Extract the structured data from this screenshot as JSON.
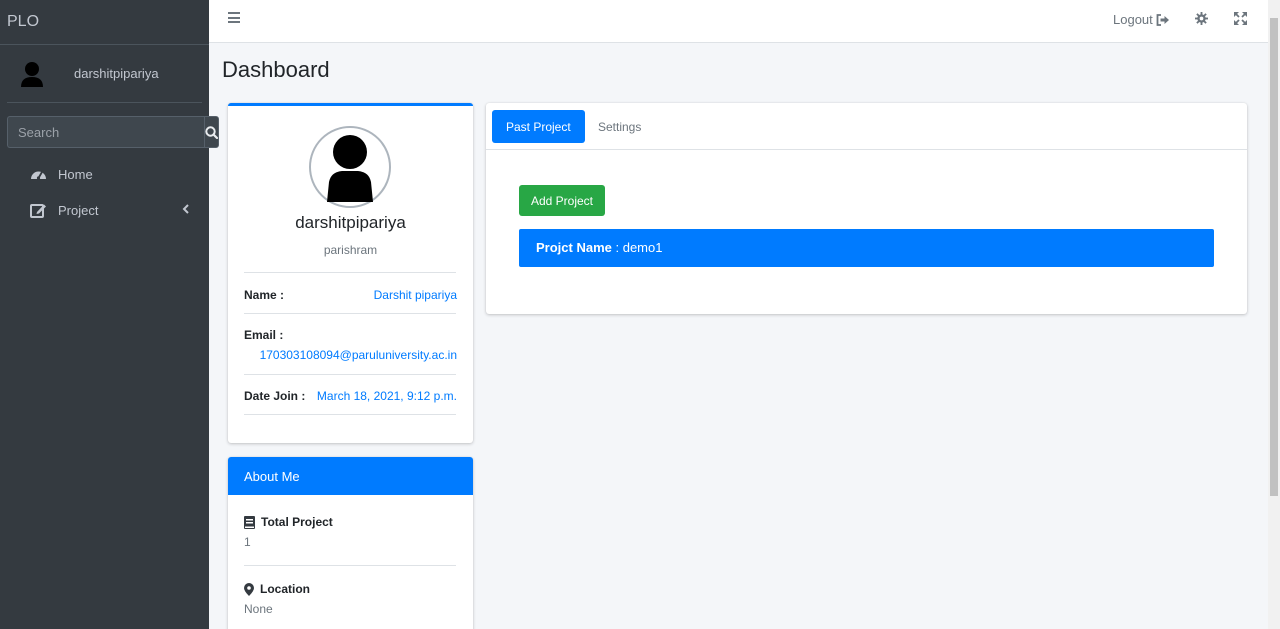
{
  "sidebar": {
    "brand": "PLO",
    "user_name": "darshitpipariya",
    "search_placeholder": "Search",
    "items": [
      {
        "label": "Home",
        "icon": "dashboard-icon"
      },
      {
        "label": "Project",
        "icon": "edit-icon"
      }
    ]
  },
  "topbar": {
    "logout_label": "Logout"
  },
  "page": {
    "title": "Dashboard"
  },
  "profile": {
    "name": "darshitpipariya",
    "subtitle": "parishram",
    "name_label": "Name :",
    "name_value": "Darshit pipariya",
    "email_label": "Email :",
    "email_value": "170303108094@paruluniversity.ac.in",
    "date_label": "Date Join :",
    "date_value": "March 18, 2021, 9:12 p.m."
  },
  "about": {
    "header": "About Me",
    "total_label": "Total Project",
    "total_value": "1",
    "location_label": "Location",
    "location_value": "None"
  },
  "projects": {
    "tabs": [
      "Past Project",
      "Settings"
    ],
    "add_button": "Add Project",
    "rows": [
      {
        "label": "Projct Name",
        "sep": " : ",
        "value": "demo1"
      }
    ]
  },
  "colors": {
    "sidebar_bg": "#343a40",
    "primary": "#007bff",
    "success": "#28a745"
  }
}
